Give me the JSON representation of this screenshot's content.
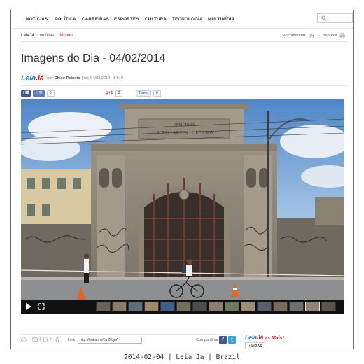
{
  "nav": {
    "items": [
      "NOTÍCIAS",
      "POLÍTICA",
      "CARREIRAS",
      "ESPORTES",
      "CULTURA",
      "TECNOLOGIA",
      "MULTIMÍDIA"
    ],
    "search_placeholder": ""
  },
  "breadcrumb": {
    "items": [
      "LeiaJá",
      "notícias",
      "Mundo"
    ],
    "separator": "›"
  },
  "tools": {
    "recommend_label": "Recomendar",
    "print_label": "Imprimir"
  },
  "page": {
    "title": "Imagens do Dia - 04/02/2014"
  },
  "byline": {
    "logo_a": "Leia",
    "logo_b": "Já",
    "prefix": "por",
    "author": "Chico Peixoto",
    "date": "| ter, 04/02/2014 - 14:19"
  },
  "social": {
    "fb_label": "f 讚",
    "share_label": "分享",
    "fb_count": "0",
    "gplus_label": "g+1",
    "gplus_count": "0",
    "tweet_label": "Tweet",
    "tweet_count": "0"
  },
  "photo": {
    "sign_line1": "OFFICINAS",
    "sign_line2": "LICEU · ARTES · OFFICIOS"
  },
  "footer": {
    "link_label": "Link:",
    "link_value": "http://leiaja.me/5m0rLyV",
    "share_label": "Compartilhar:"
  },
  "as_mais": {
    "logo_a": "Leia",
    "logo_b": "Já",
    "suffix": "as Mais!",
    "tab_label": "+ LIDAS"
  },
  "caption": "2014-02-04 | Leia Ja | Brazil",
  "colors": {
    "brand_blue": "#2b7ec1",
    "brand_red": "#d8262b",
    "facebook": "#3b5998",
    "twitter": "#2fa6de"
  }
}
